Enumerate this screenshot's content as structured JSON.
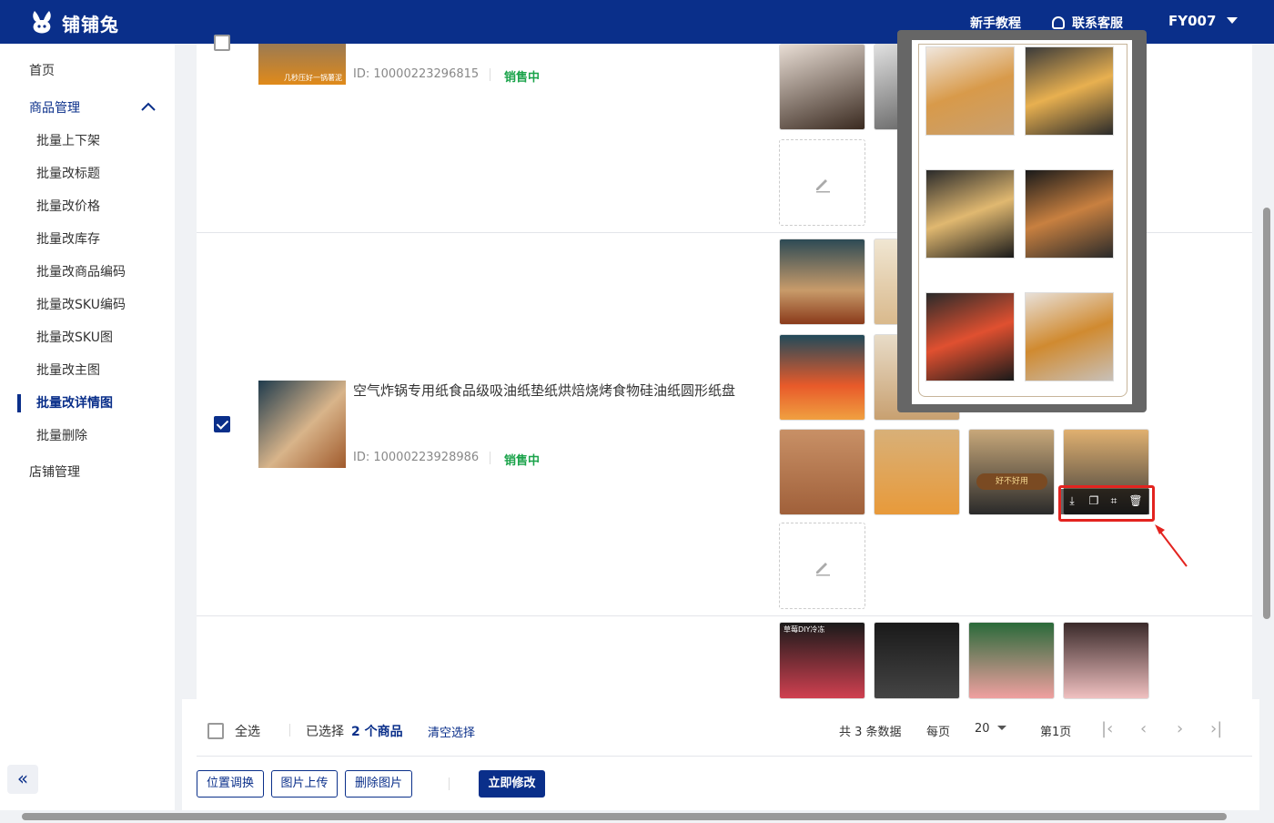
{
  "header": {
    "brand": "铺铺兔",
    "tutorial": "新手教程",
    "service": "联系客服",
    "user": "FY007"
  },
  "sidebar": {
    "home": "首页",
    "product_mgmt": "商品管理",
    "items": [
      "批量上下架",
      "批量改标题",
      "批量改价格",
      "批量改库存",
      "批量改商品编码",
      "批量改SKU编码",
      "批量改SKU图",
      "批量改主图",
      "批量改详情图",
      "批量删除"
    ],
    "active": "批量改详情图",
    "shop_mgmt": "店铺管理"
  },
  "products": [
    {
      "id": "ID: 10000223296815",
      "status": "销售中",
      "checked": false
    },
    {
      "title": "空气炸锅专用纸食品级吸油纸垫纸烘焙烧烤食物硅油纸圆形纸盘",
      "id": "ID: 10000223928986",
      "status": "销售中",
      "checked": true
    }
  ],
  "thumb_texts": {
    "product1_badge": "几秒压好一锅薯泥",
    "product2_banner": "好不好用",
    "product3_banner": "草莓DIY冷冻"
  },
  "footer": {
    "select_all": "全选",
    "selected_prefix": "已选择",
    "selected_count": "2 个商品",
    "clear": "清空选择",
    "total": "共 3 条数据",
    "per_page": "每页",
    "page_size": "20",
    "page": "第1页",
    "buttons": [
      "位置调换",
      "图片上传",
      "删除图片"
    ],
    "primary": "立即修改"
  },
  "colors": {
    "brand": "#0a2f8a",
    "status": "#1aa34a",
    "highlight": "#e3231f"
  }
}
